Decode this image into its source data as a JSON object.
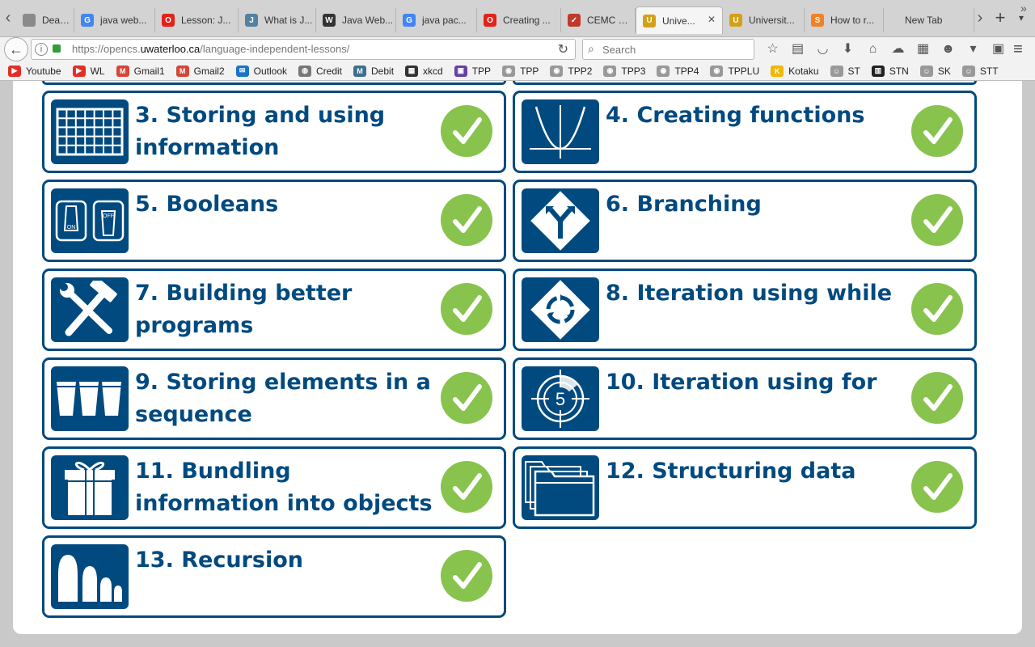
{
  "browser": {
    "tabs": [
      {
        "label": "Deadlines...",
        "favicon": "document-icon",
        "color": "#8a8a8a",
        "glyph": ""
      },
      {
        "label": "java web...",
        "favicon": "google-icon",
        "color": "#4285f4",
        "glyph": "G"
      },
      {
        "label": "Lesson: J...",
        "favicon": "oracle-icon",
        "color": "#e2231a",
        "glyph": "O"
      },
      {
        "label": "What is J...",
        "favicon": "java-icon",
        "color": "#5382a1",
        "glyph": "J"
      },
      {
        "label": "Java Web...",
        "favicon": "wikipedia-icon",
        "color": "#333333",
        "glyph": "W"
      },
      {
        "label": "java pac...",
        "favicon": "google-icon",
        "color": "#4285f4",
        "glyph": "G"
      },
      {
        "label": "Creating ...",
        "favicon": "oracle-icon",
        "color": "#e2231a",
        "glyph": "O"
      },
      {
        "label": "CEMC Co...",
        "favicon": "checkbox-icon",
        "color": "#c0392b",
        "glyph": "✓"
      },
      {
        "label": "Unive...",
        "favicon": "uwaterloo-shield-icon",
        "color": "#d4a017",
        "glyph": "U",
        "active": true
      },
      {
        "label": "Universit...",
        "favicon": "uwaterloo-shield-icon",
        "color": "#d4a017",
        "glyph": "U"
      },
      {
        "label": "How to r...",
        "favicon": "stackoverflow-icon",
        "color": "#f48024",
        "glyph": "S"
      },
      {
        "label": "New Tab",
        "favicon": "",
        "color": "",
        "glyph": ""
      }
    ],
    "url_prefix": "https://opencs.",
    "url_host": "uwaterloo.ca",
    "url_path": "/language-independent-lessons/",
    "search_placeholder": "Search",
    "bookmarks": [
      {
        "label": "Youtube",
        "icon": "youtube-icon",
        "color": "#e52d27",
        "glyph": "▶"
      },
      {
        "label": "WL",
        "icon": "youtube-icon",
        "color": "#e52d27",
        "glyph": "▶"
      },
      {
        "label": "Gmail1",
        "icon": "gmail-icon",
        "color": "#d44638",
        "glyph": "M"
      },
      {
        "label": "Gmail2",
        "icon": "gmail-icon",
        "color": "#d44638",
        "glyph": "M"
      },
      {
        "label": "Outlook",
        "icon": "mail-icon",
        "color": "#1a73c9",
        "glyph": "✉"
      },
      {
        "label": "Credit",
        "icon": "globe-icon",
        "color": "#777777",
        "glyph": "◍"
      },
      {
        "label": "Debit",
        "icon": "m-icon",
        "color": "#3d6f8e",
        "glyph": "M"
      },
      {
        "label": "xkcd",
        "icon": "xkcd-icon",
        "color": "#333333",
        "glyph": "▦"
      },
      {
        "label": "TPP",
        "icon": "twitch-icon",
        "color": "#6441a5",
        "glyph": "▣"
      },
      {
        "label": "TPP",
        "icon": "reddit-icon",
        "color": "#999999",
        "glyph": "◉"
      },
      {
        "label": "TPP2",
        "icon": "reddit-icon",
        "color": "#999999",
        "glyph": "◉"
      },
      {
        "label": "TPP3",
        "icon": "reddit-icon",
        "color": "#999999",
        "glyph": "◉"
      },
      {
        "label": "TPP4",
        "icon": "reddit-icon",
        "color": "#999999",
        "glyph": "◉"
      },
      {
        "label": "TPPLU",
        "icon": "reddit-icon",
        "color": "#999999",
        "glyph": "◉"
      },
      {
        "label": "Kotaku",
        "icon": "kotaku-icon",
        "color": "#f2b705",
        "glyph": "K"
      },
      {
        "label": "ST",
        "icon": "reddit-alien-icon",
        "color": "#999999",
        "glyph": "☺"
      },
      {
        "label": "STN",
        "icon": "building-icon",
        "color": "#222222",
        "glyph": "▥"
      },
      {
        "label": "SK",
        "icon": "reddit-alien-icon",
        "color": "#999999",
        "glyph": "☺"
      },
      {
        "label": "STT",
        "icon": "reddit-alien-icon",
        "color": "#999999",
        "glyph": "☺"
      }
    ]
  },
  "lessons": [
    {
      "title": "3. Storing and using information",
      "icon": "spreadsheet-grid-icon",
      "completed": true
    },
    {
      "title": "4. Creating functions",
      "icon": "parabola-graph-icon",
      "completed": true
    },
    {
      "title": "5. Booleans",
      "icon": "on-off-switch-icon",
      "completed": true
    },
    {
      "title": "6. Branching",
      "icon": "fork-road-sign-icon",
      "completed": true
    },
    {
      "title": "7. Building better programs",
      "icon": "hammer-wrench-icon",
      "completed": true
    },
    {
      "title": "8. Iteration using while",
      "icon": "roundabout-sign-icon",
      "completed": true
    },
    {
      "title": "9. Storing elements in a sequence",
      "icon": "cups-icon",
      "completed": true
    },
    {
      "title": "10. Iteration using for",
      "icon": "film-countdown-icon",
      "completed": true
    },
    {
      "title": "11. Bundling information into objects",
      "icon": "gift-box-icon",
      "completed": true
    },
    {
      "title": "12. Structuring data",
      "icon": "folders-icon",
      "completed": true
    },
    {
      "title": "13. Recursion",
      "icon": "nesting-dolls-icon",
      "completed": true
    }
  ],
  "colors": {
    "brand_blue": "#004a7f",
    "check_green": "#88c34e"
  }
}
